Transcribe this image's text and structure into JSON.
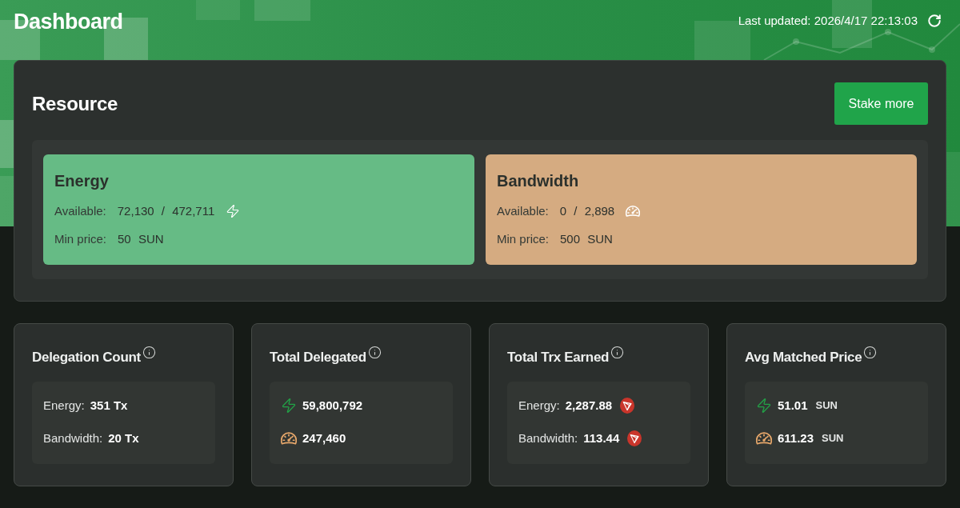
{
  "header": {
    "title": "Dashboard",
    "last_updated": "Last updated: 2026/4/17 22:13:03"
  },
  "resource": {
    "title": "Resource",
    "action": "Stake more",
    "cards": [
      {
        "kind": "energy",
        "title": "Energy",
        "available_label": "Available:",
        "available": "72,130 / 472,711",
        "price_label": "Min price:",
        "price": "50 SUN"
      },
      {
        "kind": "bandwidth",
        "title": "Bandwidth",
        "available_label": "Available:",
        "available": "0 / 2,898",
        "price_label": "Min price:",
        "price": "500 SUN"
      }
    ]
  },
  "stats": [
    {
      "kind": "count",
      "title": "Delegation Count",
      "rows": [
        {
          "label": "Energy:",
          "value": "351 Tx"
        },
        {
          "label": "Bandwidth:",
          "value": "20 Tx"
        }
      ]
    },
    {
      "kind": "amount",
      "title": "Total Delegated",
      "rows": [
        {
          "kind": "energy",
          "value": "59,800,792"
        },
        {
          "kind": "bandwidth",
          "value": "247,460"
        }
      ]
    },
    {
      "kind": "earned",
      "title": "Total Trx Earned",
      "rows": [
        {
          "label": "Energy:",
          "value": "2,287.88"
        },
        {
          "label": "Bandwidth:",
          "value": "113.44"
        }
      ]
    },
    {
      "kind": "price",
      "title": "Avg Matched Price",
      "rows": [
        {
          "kind": "energy",
          "value": "51.01",
          "unit": "SUN"
        },
        {
          "kind": "bandwidth",
          "value": "611.23",
          "unit": "SUN"
        }
      ]
    }
  ]
}
